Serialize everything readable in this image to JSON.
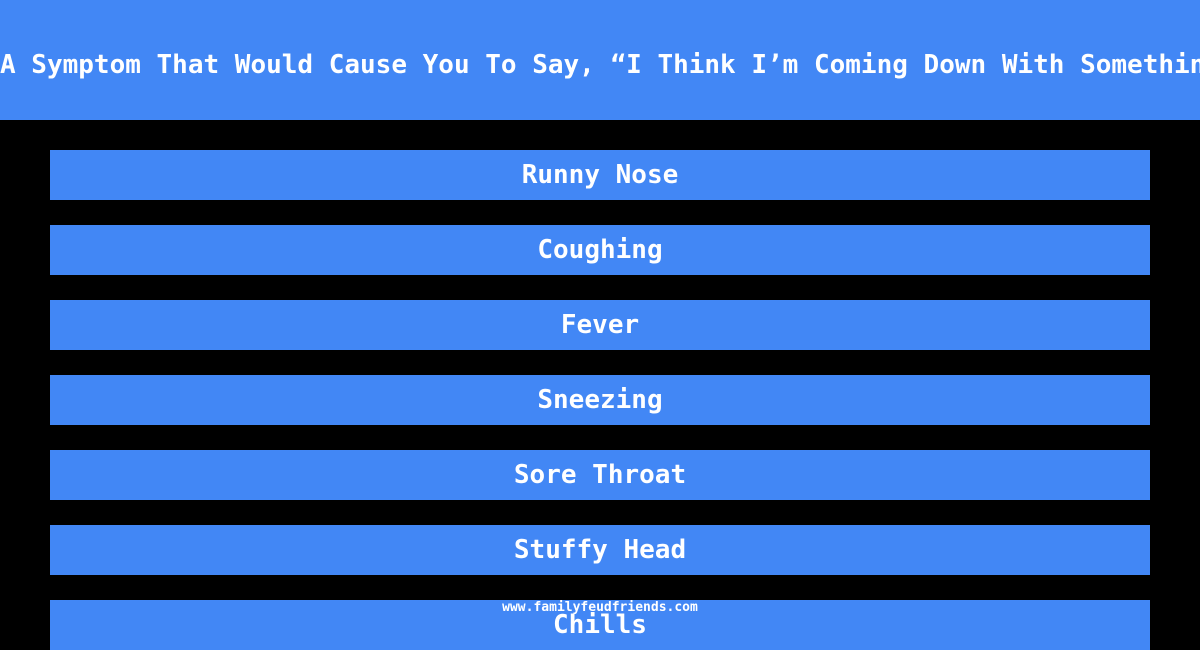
{
  "question": "A Symptom That Would Cause You To Say, “I Think I’m Coming Down With Something”",
  "answers": [
    "Runny Nose",
    "Coughing",
    "Fever",
    "Sneezing",
    "Sore Throat",
    "Stuffy Head",
    "Chills"
  ],
  "footer": "www.familyfeudfriends.com",
  "colors": {
    "accent": "#4287f5",
    "background": "#000000",
    "text": "#ffffff"
  }
}
